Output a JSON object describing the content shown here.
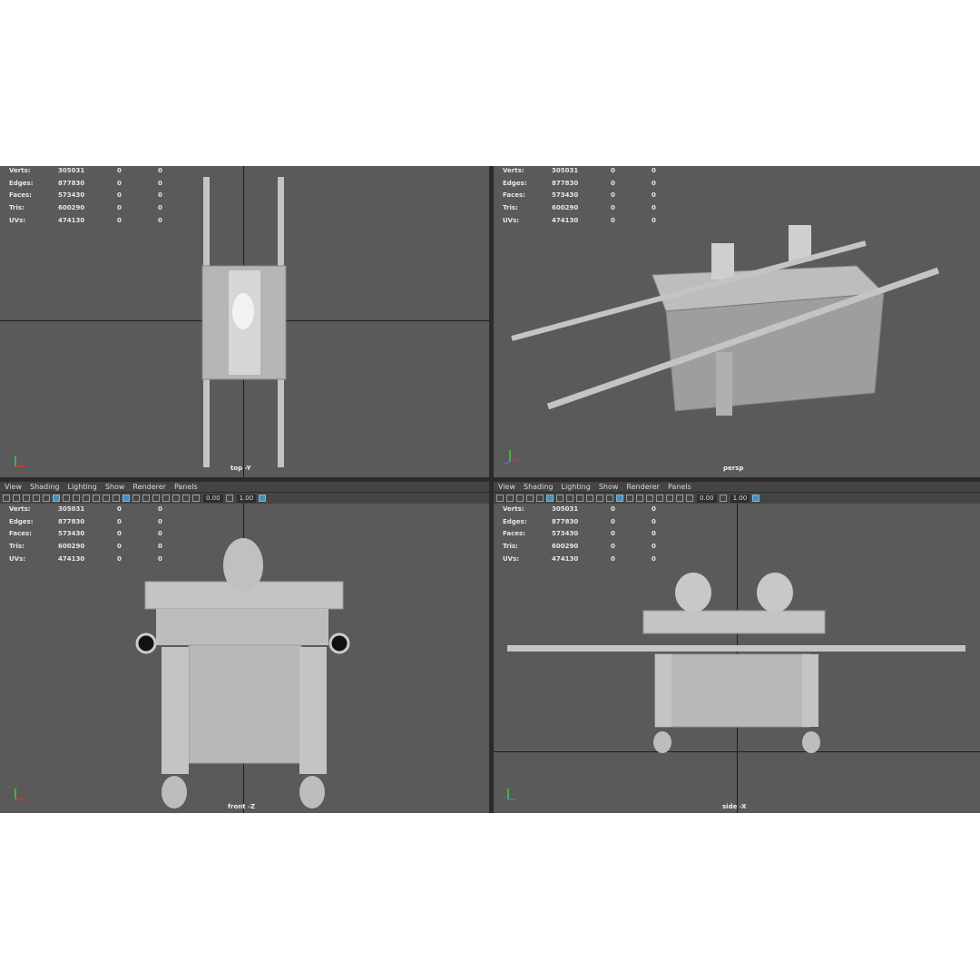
{
  "stats": {
    "rows": [
      {
        "label": "Verts:",
        "value": "305031",
        "sel": "0",
        "extra": "0"
      },
      {
        "label": "Edges:",
        "value": "877830",
        "sel": "0",
        "extra": "0"
      },
      {
        "label": "Faces:",
        "value": "573430",
        "sel": "0",
        "extra": "0"
      },
      {
        "label": "Tris:",
        "value": "600290",
        "sel": "0",
        "extra": "0"
      },
      {
        "label": "UVs:",
        "value": "474130",
        "sel": "0",
        "extra": "0"
      }
    ]
  },
  "menu": {
    "view": "View",
    "shading": "Shading",
    "lighting": "Lighting",
    "show": "Show",
    "renderer": "Renderer",
    "panels": "Panels"
  },
  "toolbar": {
    "value_a": "0.00",
    "value_b": "1.00"
  },
  "cameras": {
    "top": "top -Y",
    "persp": "persp",
    "front": "front -Z",
    "side": "side -X"
  },
  "colors": {
    "viewport_bg": "#5a5a5a",
    "model": "#c4c4c4",
    "accent": "#4a90b8"
  }
}
